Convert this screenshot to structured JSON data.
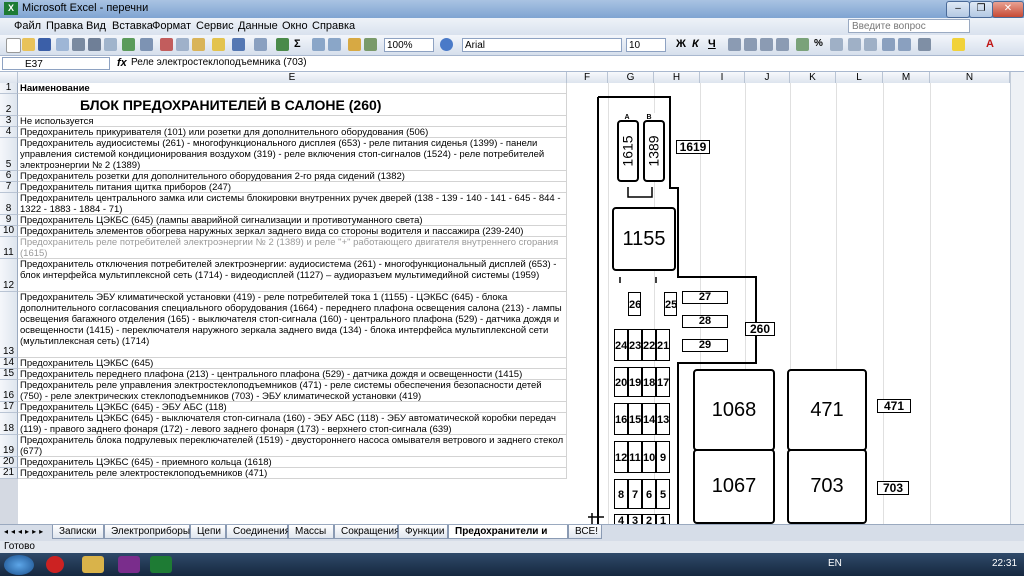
{
  "window": {
    "title": "Microsoft Excel - перечни"
  },
  "menu": {
    "items": [
      "Файл",
      "Правка",
      "Вид",
      "Вставка",
      "Формат",
      "Сервис",
      "Данные",
      "Окно",
      "Справка"
    ],
    "search_placeholder": "Введите вопрос"
  },
  "toolbar": {
    "zoom": "100%",
    "font": "Arial",
    "size": "10",
    "bold": "Ж",
    "italic": "К",
    "underline": "Ч"
  },
  "formula_bar": {
    "cell_ref": "E37",
    "fx": "fx",
    "content": "Реле электростеклоподъемника (703)"
  },
  "columns": [
    "E",
    "F",
    "G",
    "H",
    "I",
    "J",
    "K",
    "L",
    "M",
    "N"
  ],
  "rows": [
    {
      "n": "1",
      "text": "Наименование",
      "bold": true
    },
    {
      "n": "2",
      "text": "БЛОК ПРЕДОХРАНИТЕЛЕЙ В САЛОНЕ (260)",
      "title": true
    },
    {
      "n": "3",
      "text": "Не используется"
    },
    {
      "n": "4",
      "text": "Предохранитель прикуривателя (101) или розетки для дополнительного оборудования (506)"
    },
    {
      "n": "5",
      "text": "Предохранитель аудиосистемы (261) - многофункционального дисплея (653) - реле питания сиденья (1399) - панели управления системой кондиционирования воздухом (319) - реле включения стоп-сигналов (1524) - реле потребителей электроэнергии № 2 (1389)"
    },
    {
      "n": "6",
      "text": "Предохранитель розетки для дополнительного оборудования 2-го ряда сидений (1382)"
    },
    {
      "n": "7",
      "text": "Предохранитель питания щитка приборов (247)"
    },
    {
      "n": "8",
      "text": "Предохранитель центрального замка или системы блокировки внутренних ручек дверей (138 - 139 - 140 - 141 - 645 - 844 - 1322 - 1883 - 1884 - 71)"
    },
    {
      "n": "9",
      "text": "Предохранитель ЦЭКБС (645) (лампы аварийной сигнализации и противотуманного света)"
    },
    {
      "n": "10",
      "text": "Предохранитель элементов обогрева наружных зеркал заднего вида со стороны водителя и пассажира (239-240)"
    },
    {
      "n": "11",
      "text": "Предохранитель реле потребителей электроэнергии № 2 (1389) и реле \"+\" работающего двигателя внутреннего сгорания (1615)",
      "grey": true
    },
    {
      "n": "12",
      "text": "Предохранитель отключения потребителей электроэнергии: аудиосистема (261) - многофункциональный дисплей (653) - блок интерфейса мультиплексной сеть (1714) - видеодисплей (1127) – аудиоразъем мультимедийной системы (1959)"
    },
    {
      "n": "13",
      "text": "Предохранитель ЭБУ климатической установки (419) - реле потребителей тока 1 (1155) - ЦЭКБС (645) - блока дополнительного согласования специального оборудования (1664) - переднего плафона освещения салона (213) - лампы освещения багажного отделения (165) - выключателя стоп-сигнала (160) - центрального плафона (529) - датчика дождя и освещенности (1415) - переключателя наружного зеркала заднего вида (134) - блока интерфейса мультиплексной сети (мультиплексная сеть) (1714)"
    },
    {
      "n": "14",
      "text": "Предохранитель ЦЭКБС (645)"
    },
    {
      "n": "15",
      "text": "Предохранитель переднего плафона (213) - центрального плафона (529) - датчика дождя и освещенности (1415)"
    },
    {
      "n": "16",
      "text": "Предохранитель реле управления электростеклоподъемников (471) - реле системы обеспечения безопасности детей (750) - реле электрических стеклоподъемников (703) - ЭБУ климатической установки (419)"
    },
    {
      "n": "17",
      "text": "Предохранитель ЦЭКБС (645) - ЭБУ АБС (118)"
    },
    {
      "n": "18",
      "text": "Предохранитель ЦЭКБС (645) - выключателя стоп-сигнала (160) - ЭБУ АБС (118) - ЭБУ автоматической коробки передач (119) - правого заднего фонаря (172) - левого заднего фонаря (173) - верхнего стоп-сигнала (639)"
    },
    {
      "n": "19",
      "text": "Предохранитель блока подрулевых переключателей (1519) - двустороннего насоса омывателя ветрового и заднего стекол (677)"
    },
    {
      "n": "20",
      "text": "Предохранитель ЦЭКБС (645) - приемного кольца (1618)"
    },
    {
      "n": "21",
      "text": "Предохранитель реле электростеклоподъемников (471)"
    }
  ],
  "diagram": {
    "labels": {
      "a": "A",
      "b": "B",
      "f1615": "1615",
      "f1389": "1389",
      "tag1619": "1619",
      "f1155": "1155",
      "tag260": "260",
      "f1068": "1068",
      "f471": "471",
      "tag471": "471",
      "f1067": "1067",
      "f703": "703",
      "tag703": "703"
    },
    "small_fuses": [
      "26",
      "25",
      "24",
      "23",
      "22",
      "21",
      "20",
      "19",
      "18",
      "17",
      "16",
      "15",
      "14",
      "13",
      "12",
      "11",
      "10",
      "9",
      "8",
      "7",
      "6",
      "5",
      "4",
      "3",
      "2",
      "1"
    ],
    "relays": [
      "27",
      "28",
      "29"
    ]
  },
  "sheet_tabs": [
    "Записки",
    "Электроприборы",
    "Цепи",
    "Соединения",
    "Массы",
    "Сокращения",
    "Функции",
    "Предохранители и реле",
    "ВСЕ!"
  ],
  "active_tab": "Предохранители и реле",
  "status": "Готово",
  "tray": {
    "lang": "EN",
    "time": "22:31"
  },
  "colors": {
    "title_bar": "#8fb0da",
    "taskbar": "#1f3550",
    "excel_green": "#1e7b34"
  }
}
